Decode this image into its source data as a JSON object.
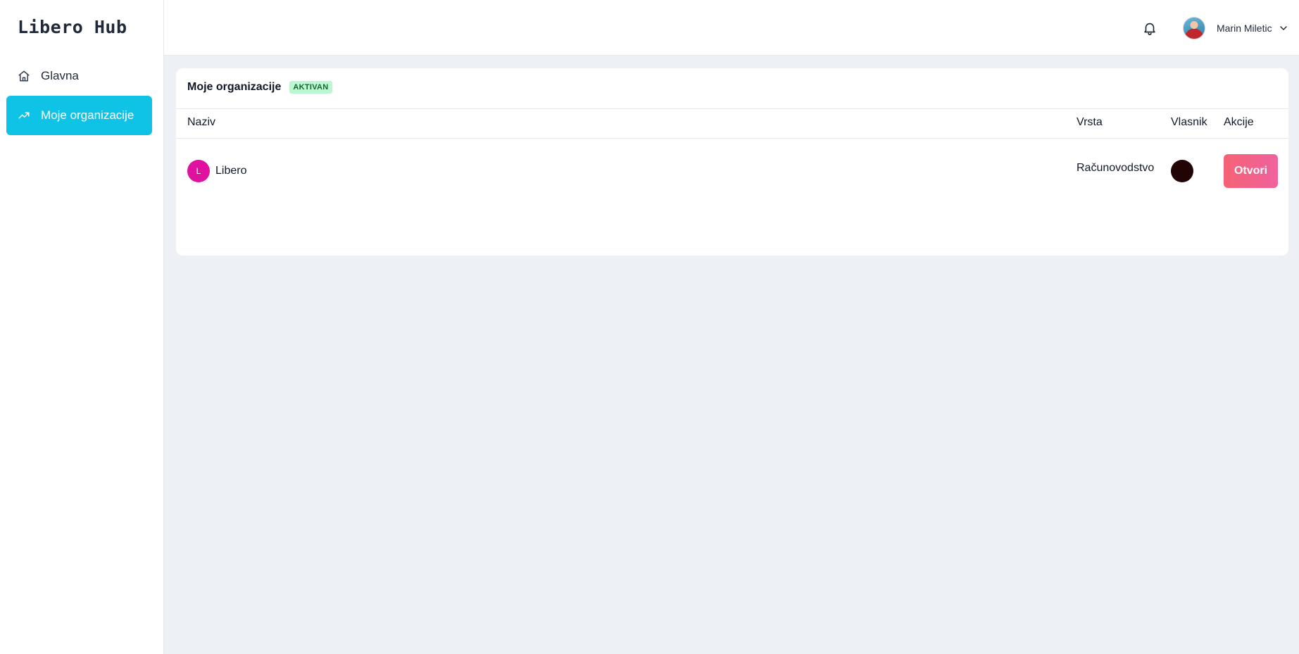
{
  "app": {
    "logo": "Libero Hub"
  },
  "sidebar": {
    "items": [
      {
        "label": "Glavna",
        "icon": "home-icon",
        "active": false
      },
      {
        "label": "Moje organizacije",
        "icon": "trending-up-icon",
        "active": true
      }
    ]
  },
  "header": {
    "notifications_icon": "bell-icon",
    "user": {
      "name": "Marin Miletic",
      "avatar_icon": "user-avatar",
      "menu_icon": "chevron-down-icon"
    }
  },
  "card": {
    "title": "Moje organizacije",
    "badge": "AKTIVAN",
    "columns": [
      "Naziv",
      "Vrsta",
      "Vlasnik",
      "Akcije"
    ],
    "rows": [
      {
        "initial": "L",
        "name": "Libero",
        "type": "Računovodstvo",
        "owner_avatar_color": "#220405",
        "action_label": "Otvori"
      }
    ]
  },
  "colors": {
    "accent": "#0fc3e6",
    "badge_bg": "#bbf7d0",
    "badge_text": "#166534",
    "org_avatar": "#e0119e",
    "button_gradient_start": "#f56275",
    "button_gradient_end": "#ef629e",
    "background": "#edf1f5"
  }
}
